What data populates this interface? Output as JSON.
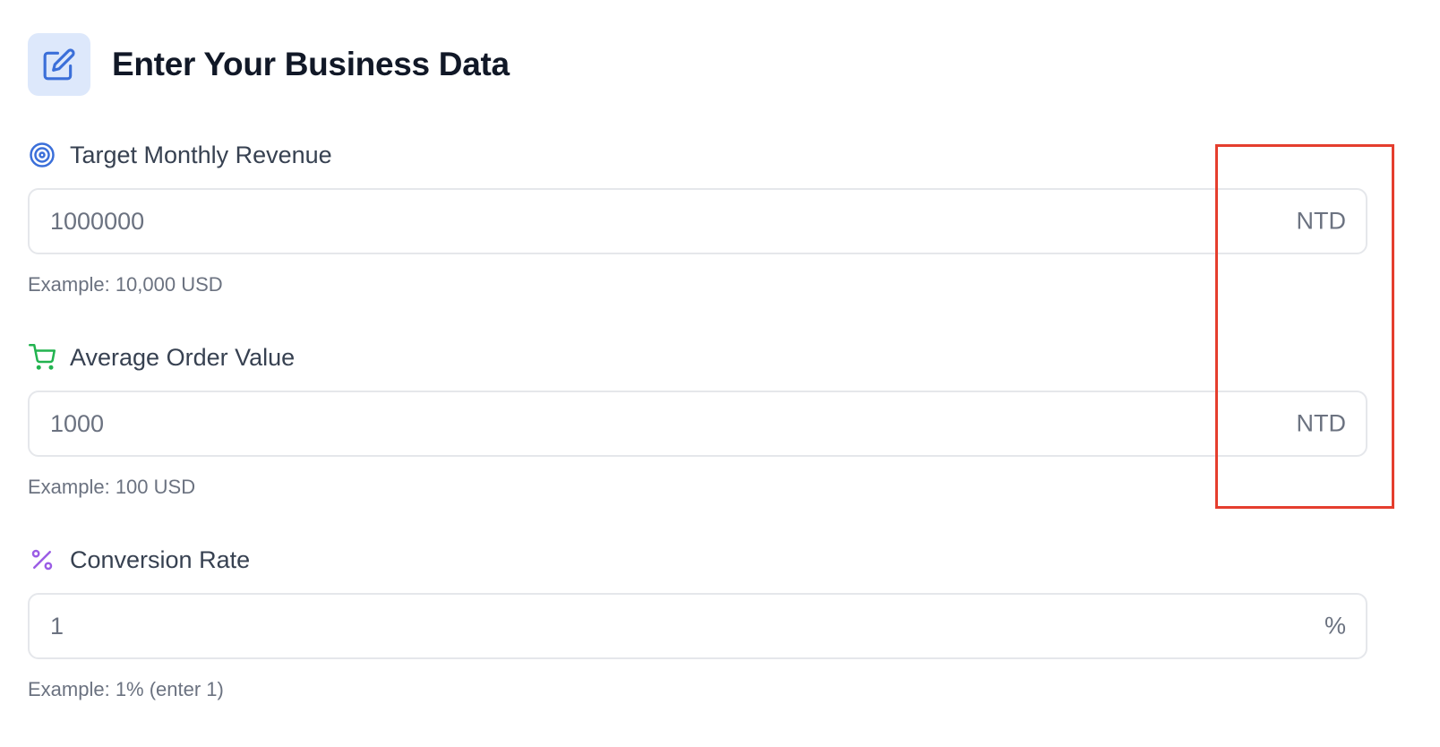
{
  "header": {
    "title": "Enter Your Business Data",
    "icon": "edit-icon"
  },
  "fields": [
    {
      "label": "Target Monthly Revenue",
      "icon": "target-icon",
      "icon_color": "#3b6fd9",
      "value": "1000000",
      "placeholder": "",
      "unit": "NTD",
      "hint": "Example: 10,000 USD"
    },
    {
      "label": "Average Order Value",
      "icon": "cart-icon",
      "icon_color": "#22b34f",
      "value": "1000",
      "placeholder": "",
      "unit": "NTD",
      "hint": "Example: 100 USD"
    },
    {
      "label": "Conversion Rate",
      "icon": "percent-icon",
      "icon_color": "#9b5de5",
      "value": "1",
      "placeholder": "",
      "unit": "%",
      "hint": "Example: 1% (enter 1)"
    }
  ],
  "colors": {
    "accent": "#3b6fd9",
    "header_icon_bg": "#dde8fb",
    "highlight": "#e53e2e"
  }
}
